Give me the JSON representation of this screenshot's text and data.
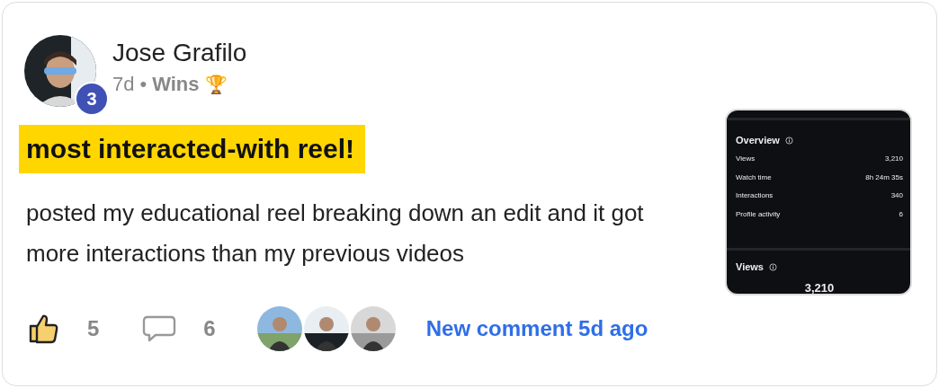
{
  "post": {
    "author": "Jose Grafilo",
    "badge": "3",
    "age": "7d",
    "separator": "•",
    "category": "Wins",
    "category_icon": "🏆",
    "headline": "most interacted-with reel!",
    "body": "posted my educational reel breaking down an edit and it got more interactions than my previous videos"
  },
  "thumbnail": {
    "section_title": "Overview",
    "rows": [
      {
        "label": "Views",
        "value": "3,210"
      },
      {
        "label": "Watch time",
        "value": "8h 24m 35s"
      },
      {
        "label": "Interactions",
        "value": "340"
      },
      {
        "label": "Profile activity",
        "value": "6"
      }
    ],
    "views_title": "Views",
    "views_total": "3,210"
  },
  "footer": {
    "likes": "5",
    "comments": "6",
    "activity_link": "New comment 5d ago"
  }
}
